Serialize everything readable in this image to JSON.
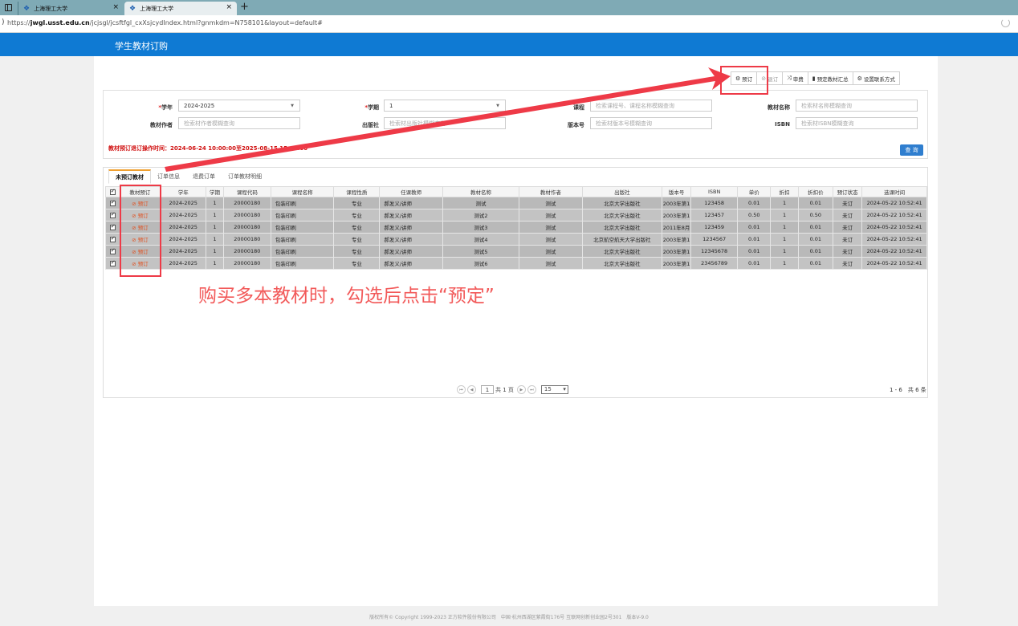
{
  "browser": {
    "tabs": [
      {
        "title": "上海理工大学"
      },
      {
        "title": "上海理工大学"
      }
    ],
    "url_prefix": "https://",
    "url_host": "jwgl.usst.edu.cn",
    "url_path": "/jcjsgl/jcsftfgl_cxXsjcydIndex.html?gnmkdm=N758101&layout=default#"
  },
  "app": {
    "title": "学生教材订购"
  },
  "toolbar": [
    {
      "label": "预订",
      "icon": "⚙",
      "muted": false
    },
    {
      "label": "退订",
      "icon": "⊘",
      "muted": true
    },
    {
      "label": "审费",
      "icon": "⤨",
      "muted": false
    },
    {
      "label": "预定教材汇总",
      "icon": "▮",
      "muted": false
    },
    {
      "label": "设置联系方式",
      "icon": "⚙",
      "muted": false
    }
  ],
  "search": {
    "year_label": "学年",
    "year_value": "2024-2025",
    "term_label": "学期",
    "term_value": "1",
    "course_label": "课程",
    "course_placeholder": "检索课程号、课程名称模糊查询",
    "book_name_label": "教材名称",
    "book_name_placeholder": "检索材名称模糊查询",
    "author_label": "教材作者",
    "author_placeholder": "检索材作者模糊查询",
    "publisher_label": "出版社",
    "publisher_placeholder": "检索材出版社模糊查询",
    "edition_label": "版本号",
    "edition_placeholder": "检索材版本号模糊查询",
    "isbn_label": "ISBN",
    "isbn_placeholder": "检索材ISBN模糊查询",
    "notice": "教材预订退订操作时间：2024-06-24 10:00:00至2025-08-15 15:00:00",
    "query_label": "查 询"
  },
  "grid_tabs": [
    "未预订教材",
    "订单信息",
    "退费订单",
    "订单教材明细"
  ],
  "columns": [
    "教材预订",
    "学年",
    "学期",
    "课程代码",
    "课程名称",
    "课程性质",
    "任课教师",
    "教材名称",
    "教材作者",
    "出版社",
    "版本号",
    "ISBN",
    "单价",
    "折扣",
    "折扣价",
    "预订状态",
    "选课时间"
  ],
  "rows": [
    [
      "⊘ 预订",
      "2024-2025",
      "1",
      "20000180",
      "包装印刷",
      "专业",
      "郝发义/讲师",
      "测试",
      "测试",
      "北京大学出版社",
      "2003年第1",
      "123458",
      "0.01",
      "1",
      "0.01",
      "未订",
      "2024-05-22 10:52:41"
    ],
    [
      "⊘ 预订",
      "2024-2025",
      "1",
      "20000180",
      "包装印刷",
      "专业",
      "郝发义/讲师",
      "测试2",
      "测试",
      "北京大学出版社",
      "2003年第1",
      "123457",
      "0.50",
      "1",
      "0.50",
      "未订",
      "2024-05-22 10:52:41"
    ],
    [
      "⊘ 预订",
      "2024-2025",
      "1",
      "20000180",
      "包装印刷",
      "专业",
      "郝发义/讲师",
      "测试3",
      "测试",
      "北京大学出版社",
      "2011年8月",
      "123459",
      "0.01",
      "1",
      "0.01",
      "未订",
      "2024-05-22 10:52:41"
    ],
    [
      "⊘ 预订",
      "2024-2025",
      "1",
      "20000180",
      "包装印刷",
      "专业",
      "郝发义/讲师",
      "测试4",
      "测试",
      "北京航空航天大学出版社",
      "2003年第1",
      "1234567",
      "0.01",
      "1",
      "0.01",
      "未订",
      "2024-05-22 10:52:41"
    ],
    [
      "⊘ 预订",
      "2024-2025",
      "1",
      "20000180",
      "包装印刷",
      "专业",
      "郝发义/讲师",
      "测试5",
      "测试",
      "北京大学出版社",
      "2003年第1",
      "12345678",
      "0.01",
      "1",
      "0.01",
      "未订",
      "2024-05-22 10:52:41"
    ],
    [
      "⊘ 预订",
      "2024-2025",
      "1",
      "20000180",
      "包装印刷",
      "专业",
      "郝发义/讲师",
      "测试6",
      "测试",
      "北京大学出版社",
      "2003年第1",
      "23456789",
      "0.01",
      "1",
      "0.01",
      "未订",
      "2024-05-22 10:52:41"
    ]
  ],
  "pager": {
    "page": "1",
    "total_pages_text": "共 1 页",
    "page_size": "15",
    "summary": "1 - 6　共 6 条"
  },
  "annotation": {
    "text": "购买多本教材时，勾选后点击“预定”"
  },
  "footer": "版权所有© Copyright 1999-2023 正方软件股份有限公司　中国·杭州西湖区紫霞街176号 互联网创新创业园2号301　版本V-9.0",
  "colors": {
    "header_blue": "#0f7ad3",
    "annotation_red": "#ee3a47",
    "selected_row": "#b9b9b9"
  }
}
